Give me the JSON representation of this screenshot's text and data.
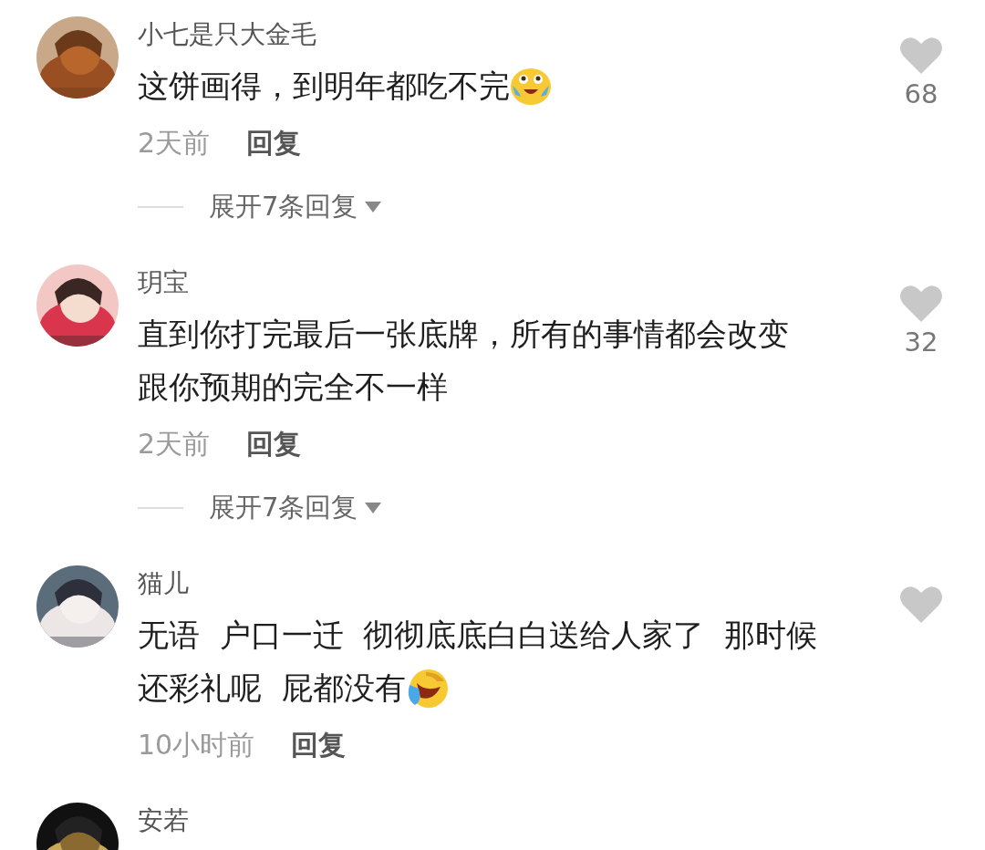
{
  "comments": [
    {
      "name": "小七是只大金毛",
      "avatar": {
        "kind": "picture"
      },
      "lines": [
        "这饼画得，到明年都吃不完"
      ],
      "emoji": {
        "kind": "tears"
      },
      "time": "2天前",
      "reply": "回复",
      "likes": "68",
      "expand": "展开7条回复"
    },
    {
      "name": "玥宝",
      "avatar": {
        "kind": "picture"
      },
      "lines": [
        "直到你打完最后一张底牌，所有的事情都会改变",
        "跟你预期的完全不一样"
      ],
      "time": "2天前",
      "reply": "回复",
      "likes": "32",
      "expand": "展开7条回复"
    },
    {
      "name": "猫儿",
      "avatar": {
        "kind": "picture"
      },
      "lines": [
        "无语  户口一迁  彻彻底底白白送给人家了  那时候",
        "还彩礼呢  屁都没有"
      ],
      "emoji": {
        "kind": "rofl"
      },
      "time": "10小时前",
      "reply": "回复"
    },
    {
      "name": "安若",
      "avatar": {
        "kind": "picture"
      }
    }
  ]
}
